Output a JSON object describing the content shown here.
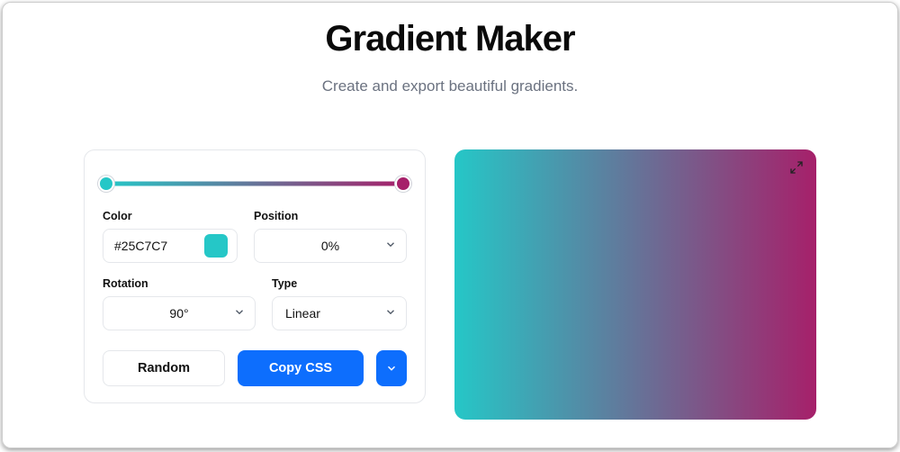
{
  "header": {
    "title": "Gradient Maker",
    "subtitle": "Create and export beautiful gradients."
  },
  "gradient": {
    "stops": [
      {
        "color": "#25C7C7",
        "position": 0
      },
      {
        "color": "#A6206A",
        "position": 100
      }
    ]
  },
  "fields": {
    "color_label": "Color",
    "color_value": "#25C7C7",
    "position_label": "Position",
    "position_value": "0%",
    "rotation_label": "Rotation",
    "rotation_value": "90°",
    "type_label": "Type",
    "type_value": "Linear"
  },
  "actions": {
    "random": "Random",
    "copy_css": "Copy CSS"
  },
  "icons": {
    "chevron_down": "chevron-down",
    "expand": "expand"
  }
}
